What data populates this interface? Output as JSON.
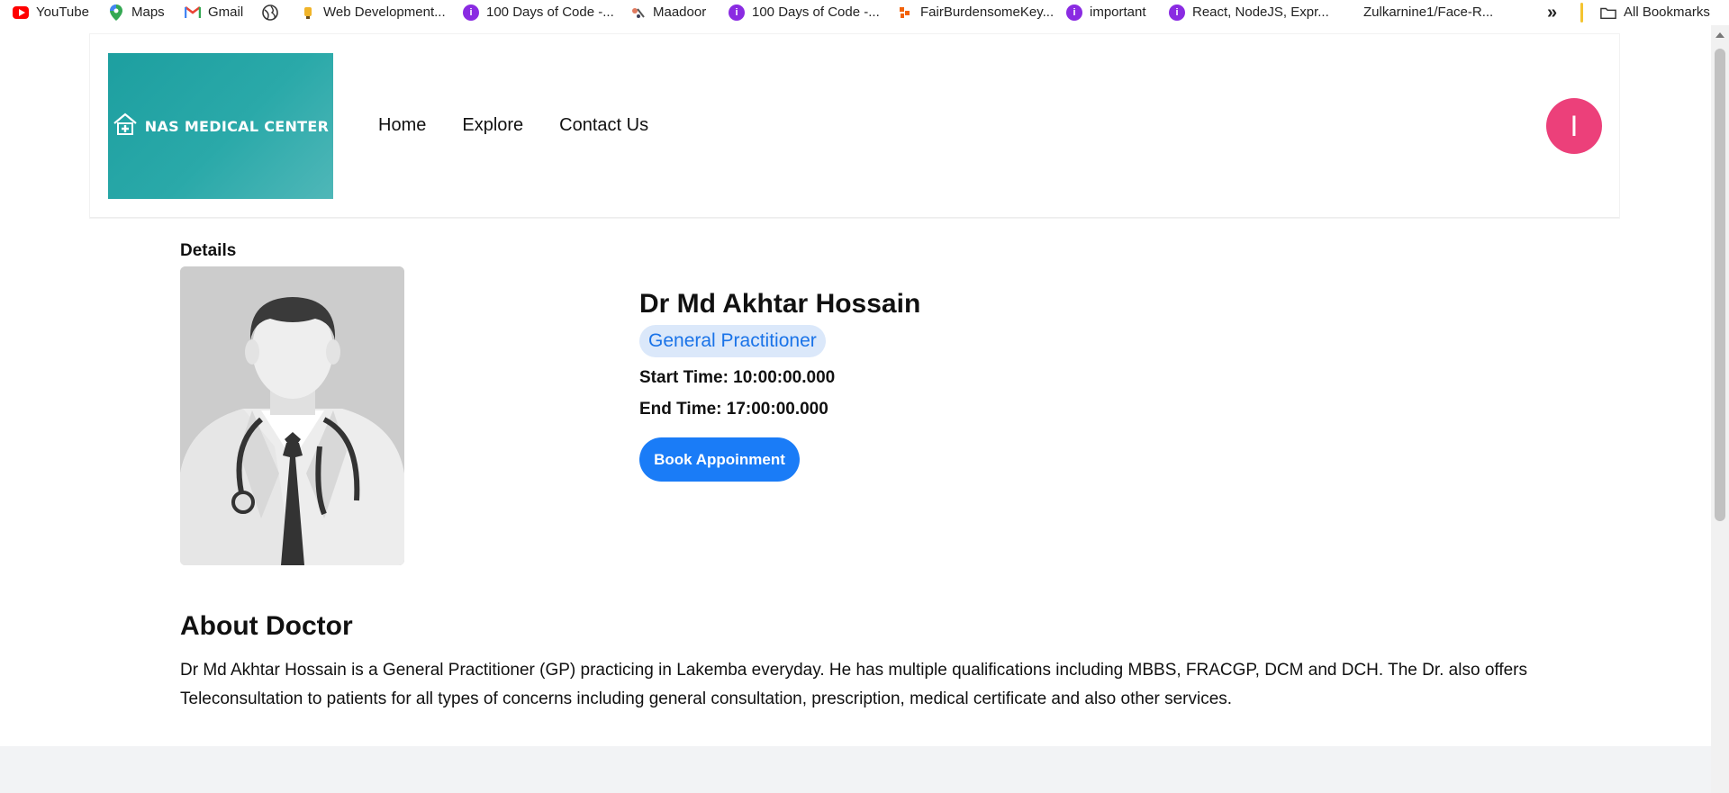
{
  "bookmarks": [
    {
      "label": "YouTube",
      "icon": "youtube-icon"
    },
    {
      "label": "Maps",
      "icon": "maps-pin-icon"
    },
    {
      "label": "Gmail",
      "icon": "gmail-icon"
    },
    {
      "label": "",
      "icon": "globe-icon"
    },
    {
      "label": "Web Development...",
      "icon": "bookmark-favicon-icon"
    },
    {
      "label": "100 Days of Code -...",
      "icon": "purple-circle-icon"
    },
    {
      "label": "Maadoor",
      "icon": "maadoor-icon"
    },
    {
      "label": "100 Days of Code -...",
      "icon": "purple-circle-icon"
    },
    {
      "label": "FairBurdensomeKey...",
      "icon": "orange-favicon-icon"
    },
    {
      "label": "important",
      "icon": "purple-circle-icon"
    },
    {
      "label": "React, NodeJS, Expr...",
      "icon": "purple-circle-icon"
    },
    {
      "label": "Zulkarnine1/Face-R...",
      "icon": ""
    }
  ],
  "bookmarks_more": "»",
  "all_bookmarks": "All Bookmarks",
  "header": {
    "logo_text": "NAS MEDICAL CENTER",
    "nav": [
      "Home",
      "Explore",
      "Contact Us"
    ],
    "avatar_initial": "I",
    "avatar_color": "#ec407a"
  },
  "details": {
    "section_label": "Details",
    "doctor_name": "Dr Md Akhtar Hossain",
    "specialty": "General Practitioner",
    "start_time": "Start Time: 10:00:00.000",
    "end_time": "End Time: 17:00:00.000",
    "book_button": "Book Appoinment"
  },
  "about": {
    "title": "About Doctor",
    "text": "Dr Md Akhtar Hossain is a General Practitioner (GP) practicing in Lakemba everyday. He has multiple qualifications including MBBS, FRACGP, DCM and DCH. The Dr. also offers Teleconsultation to patients for all types of concerns including general consultation, prescription, medical certificate and also other services."
  },
  "colors": {
    "primary": "#1a7cf7",
    "specialty_bg": "#dbe8fa",
    "logo_bg": "#1d9fa0"
  }
}
